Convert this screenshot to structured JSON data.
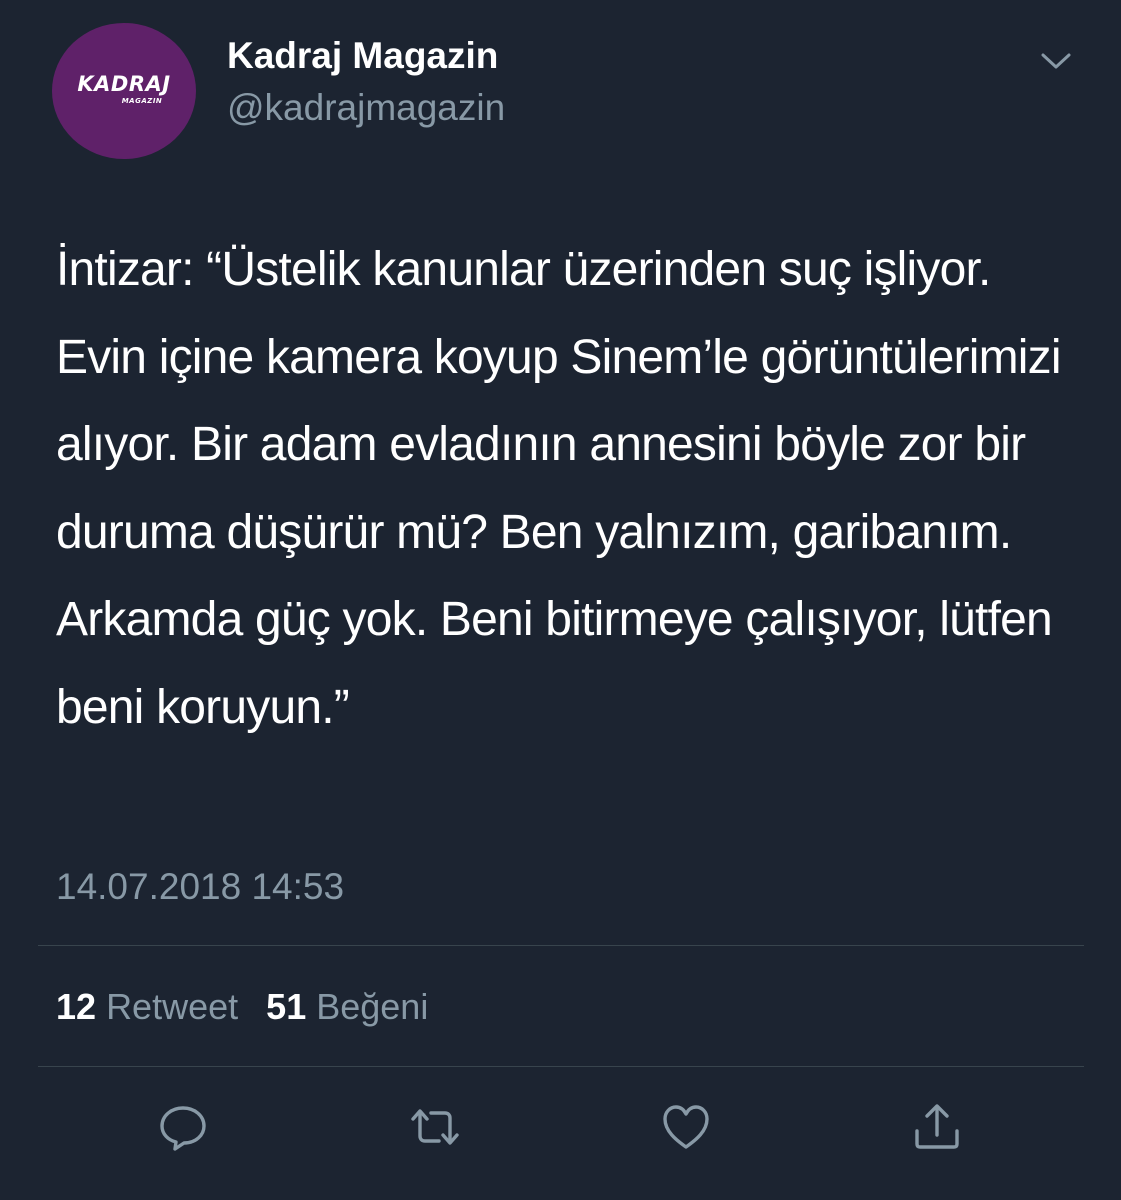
{
  "colors": {
    "background": "#1c2431",
    "text_primary": "#ffffff",
    "text_secondary": "#8899a6",
    "divider": "#38444d",
    "avatar_bg": "#5f2169"
  },
  "author": {
    "avatar_logo_text": "KADRAJ",
    "avatar_logo_subtext": "MAGAZIN",
    "display_name": "Kadraj Magazin",
    "handle": "@kadrajmagazin"
  },
  "tweet": {
    "text": "İntizar: “Üstelik kanunlar üzerinden suç işliyor. Evin içine kamera koyup Sinem’le görüntülerimizi alıyor. Bir adam evladının annesini böyle zor bir duruma düşürür mü? Ben yalnızım, garibanım. Arkamda güç yok. Beni bitirmeye çalışıyor, lütfen beni koruyun.”",
    "timestamp": "14.07.2018 14:53"
  },
  "stats": {
    "retweet_count": "12",
    "retweet_label": "Retweet",
    "like_count": "51",
    "like_label": "Beğeni"
  },
  "actions": [
    {
      "name": "reply",
      "icon": "speech-bubble-icon"
    },
    {
      "name": "retweet",
      "icon": "retweet-icon"
    },
    {
      "name": "like",
      "icon": "heart-icon"
    },
    {
      "name": "share",
      "icon": "share-icon"
    }
  ],
  "menu_icon": "chevron-down-icon"
}
